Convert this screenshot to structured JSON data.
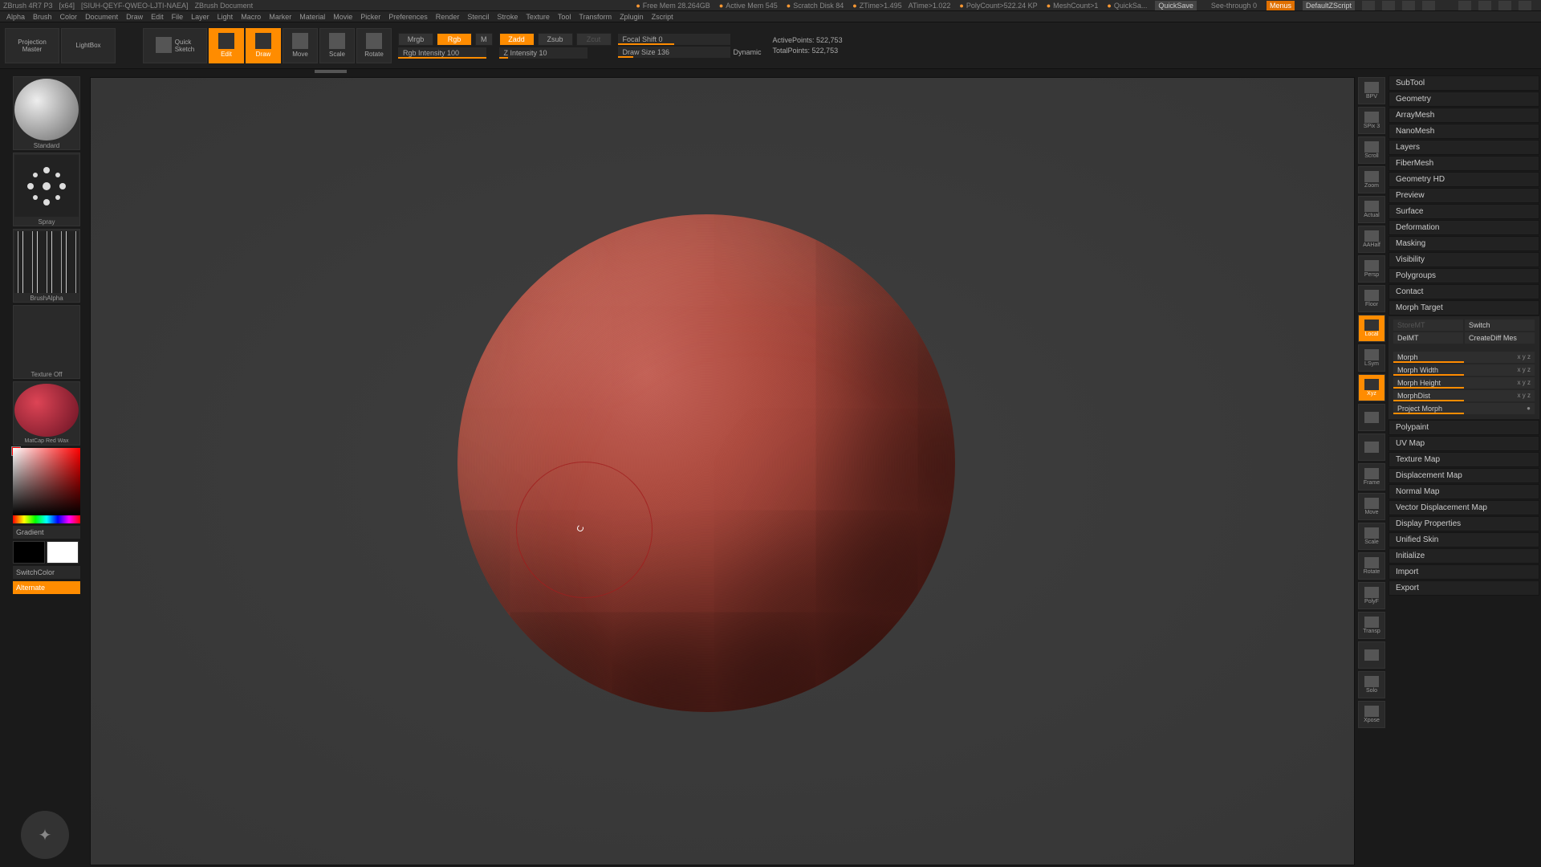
{
  "title_bar": {
    "app": "ZBrush 4R7 P3",
    "arch": "[x64]",
    "doc_id": "[SIUH-QEYF-QWEO-LJTI-NAEA]",
    "doc_name": "ZBrush Document",
    "free_mem": "Free Mem 28.264GB",
    "active_mem": "Active Mem 545",
    "scratch": "Scratch Disk 84",
    "ztime": "ZTime>1.495",
    "atime": "ATime>1.022",
    "polycount": "PolyCount>522.24 KP",
    "meshcount": "MeshCount>1",
    "quicksave_label": "QuickSa...",
    "quicksave_btn": "QuickSave",
    "seethrough": "See-through  0",
    "menus": "Menus",
    "ui": "DefaultZScript"
  },
  "menu": [
    "Alpha",
    "Brush",
    "Color",
    "Document",
    "Draw",
    "Edit",
    "File",
    "Layer",
    "Light",
    "Macro",
    "Marker",
    "Material",
    "Movie",
    "Picker",
    "Preferences",
    "Render",
    "Stencil",
    "Stroke",
    "Texture",
    "Tool",
    "Transform",
    "Zplugin",
    "Zscript"
  ],
  "toolbar": {
    "projection": "Projection\nMaster",
    "lightbox": "LightBox",
    "quicksketch": "Quick\nSketch",
    "edit": "Edit",
    "draw": "Draw",
    "move": "Move",
    "scale": "Scale",
    "rotate": "Rotate",
    "mrgb": "Mrgb",
    "rgb": "Rgb",
    "m": "M",
    "rgb_intensity": "Rgb Intensity 100",
    "zadd": "Zadd",
    "zsub": "Zsub",
    "zcut": "Zcut",
    "z_intensity": "Z Intensity 10",
    "focal_shift": "Focal Shift 0",
    "draw_size": "Draw Size 136",
    "dynamic": "Dynamic",
    "active_points": "ActivePoints: 522,753",
    "total_points": "TotalPoints: 522,753"
  },
  "left_palette": {
    "brush": "Standard",
    "stroke": "Spray",
    "alpha": "BrushAlpha",
    "texture": "Texture Off",
    "material": "MatCap Red Wax",
    "gradient": "Gradient",
    "switch_color": "SwitchColor",
    "alternate": "Alternate"
  },
  "right_nav": [
    {
      "name": "bpv",
      "label": "BPV",
      "active": false
    },
    {
      "name": "spix",
      "label": "SPix 3",
      "active": false
    },
    {
      "name": "scroll",
      "label": "Scroll",
      "active": false
    },
    {
      "name": "zoom",
      "label": "Zoom",
      "active": false
    },
    {
      "name": "actual",
      "label": "Actual",
      "active": false
    },
    {
      "name": "aahalf",
      "label": "AAHalf",
      "active": false
    },
    {
      "name": "persp",
      "label": "Persp",
      "active": false
    },
    {
      "name": "floor",
      "label": "Floor",
      "active": false
    },
    {
      "name": "local",
      "label": "Local",
      "active": true
    },
    {
      "name": "lsym",
      "label": "LSym",
      "active": false
    },
    {
      "name": "xyz",
      "label": "Xyz",
      "active": true
    },
    {
      "name": "m1",
      "label": "",
      "active": false
    },
    {
      "name": "m2",
      "label": "",
      "active": false
    },
    {
      "name": "frame",
      "label": "Frame",
      "active": false
    },
    {
      "name": "move",
      "label": "Move",
      "active": false
    },
    {
      "name": "scale",
      "label": "Scale",
      "active": false
    },
    {
      "name": "rotate",
      "label": "Rotate",
      "active": false
    },
    {
      "name": "polyf",
      "label": "PolyF",
      "active": false
    },
    {
      "name": "transp",
      "label": "Transp",
      "active": false
    },
    {
      "name": "ghost",
      "label": "",
      "active": false
    },
    {
      "name": "solo",
      "label": "Solo",
      "active": false
    },
    {
      "name": "xpose",
      "label": "Xpose",
      "active": false
    }
  ],
  "right_panel": {
    "items_top": [
      "SubTool",
      "Geometry",
      "ArrayMesh",
      "NanoMesh",
      "Layers",
      "FiberMesh",
      "Geometry HD",
      "Preview",
      "Surface",
      "Deformation",
      "Masking",
      "Visibility",
      "Polygroups",
      "Contact"
    ],
    "morph_target": {
      "title": "Morph Target",
      "storemt": "StoreMT",
      "switch": "Switch",
      "delmt": "DelMT",
      "creatediff": "CreateDiff Mes",
      "morph": "Morph",
      "morph_width": "Morph Width",
      "morph_height": "Morph Height",
      "morph_dist": "MorphDist",
      "project_morph": "Project Morph",
      "axes": "x y z"
    },
    "items_bottom": [
      "Polypaint",
      "UV Map",
      "Texture Map",
      "Displacement Map",
      "Normal Map",
      "Vector Displacement Map",
      "Display Properties",
      "Unified Skin",
      "Initialize",
      "Import",
      "Export"
    ]
  }
}
